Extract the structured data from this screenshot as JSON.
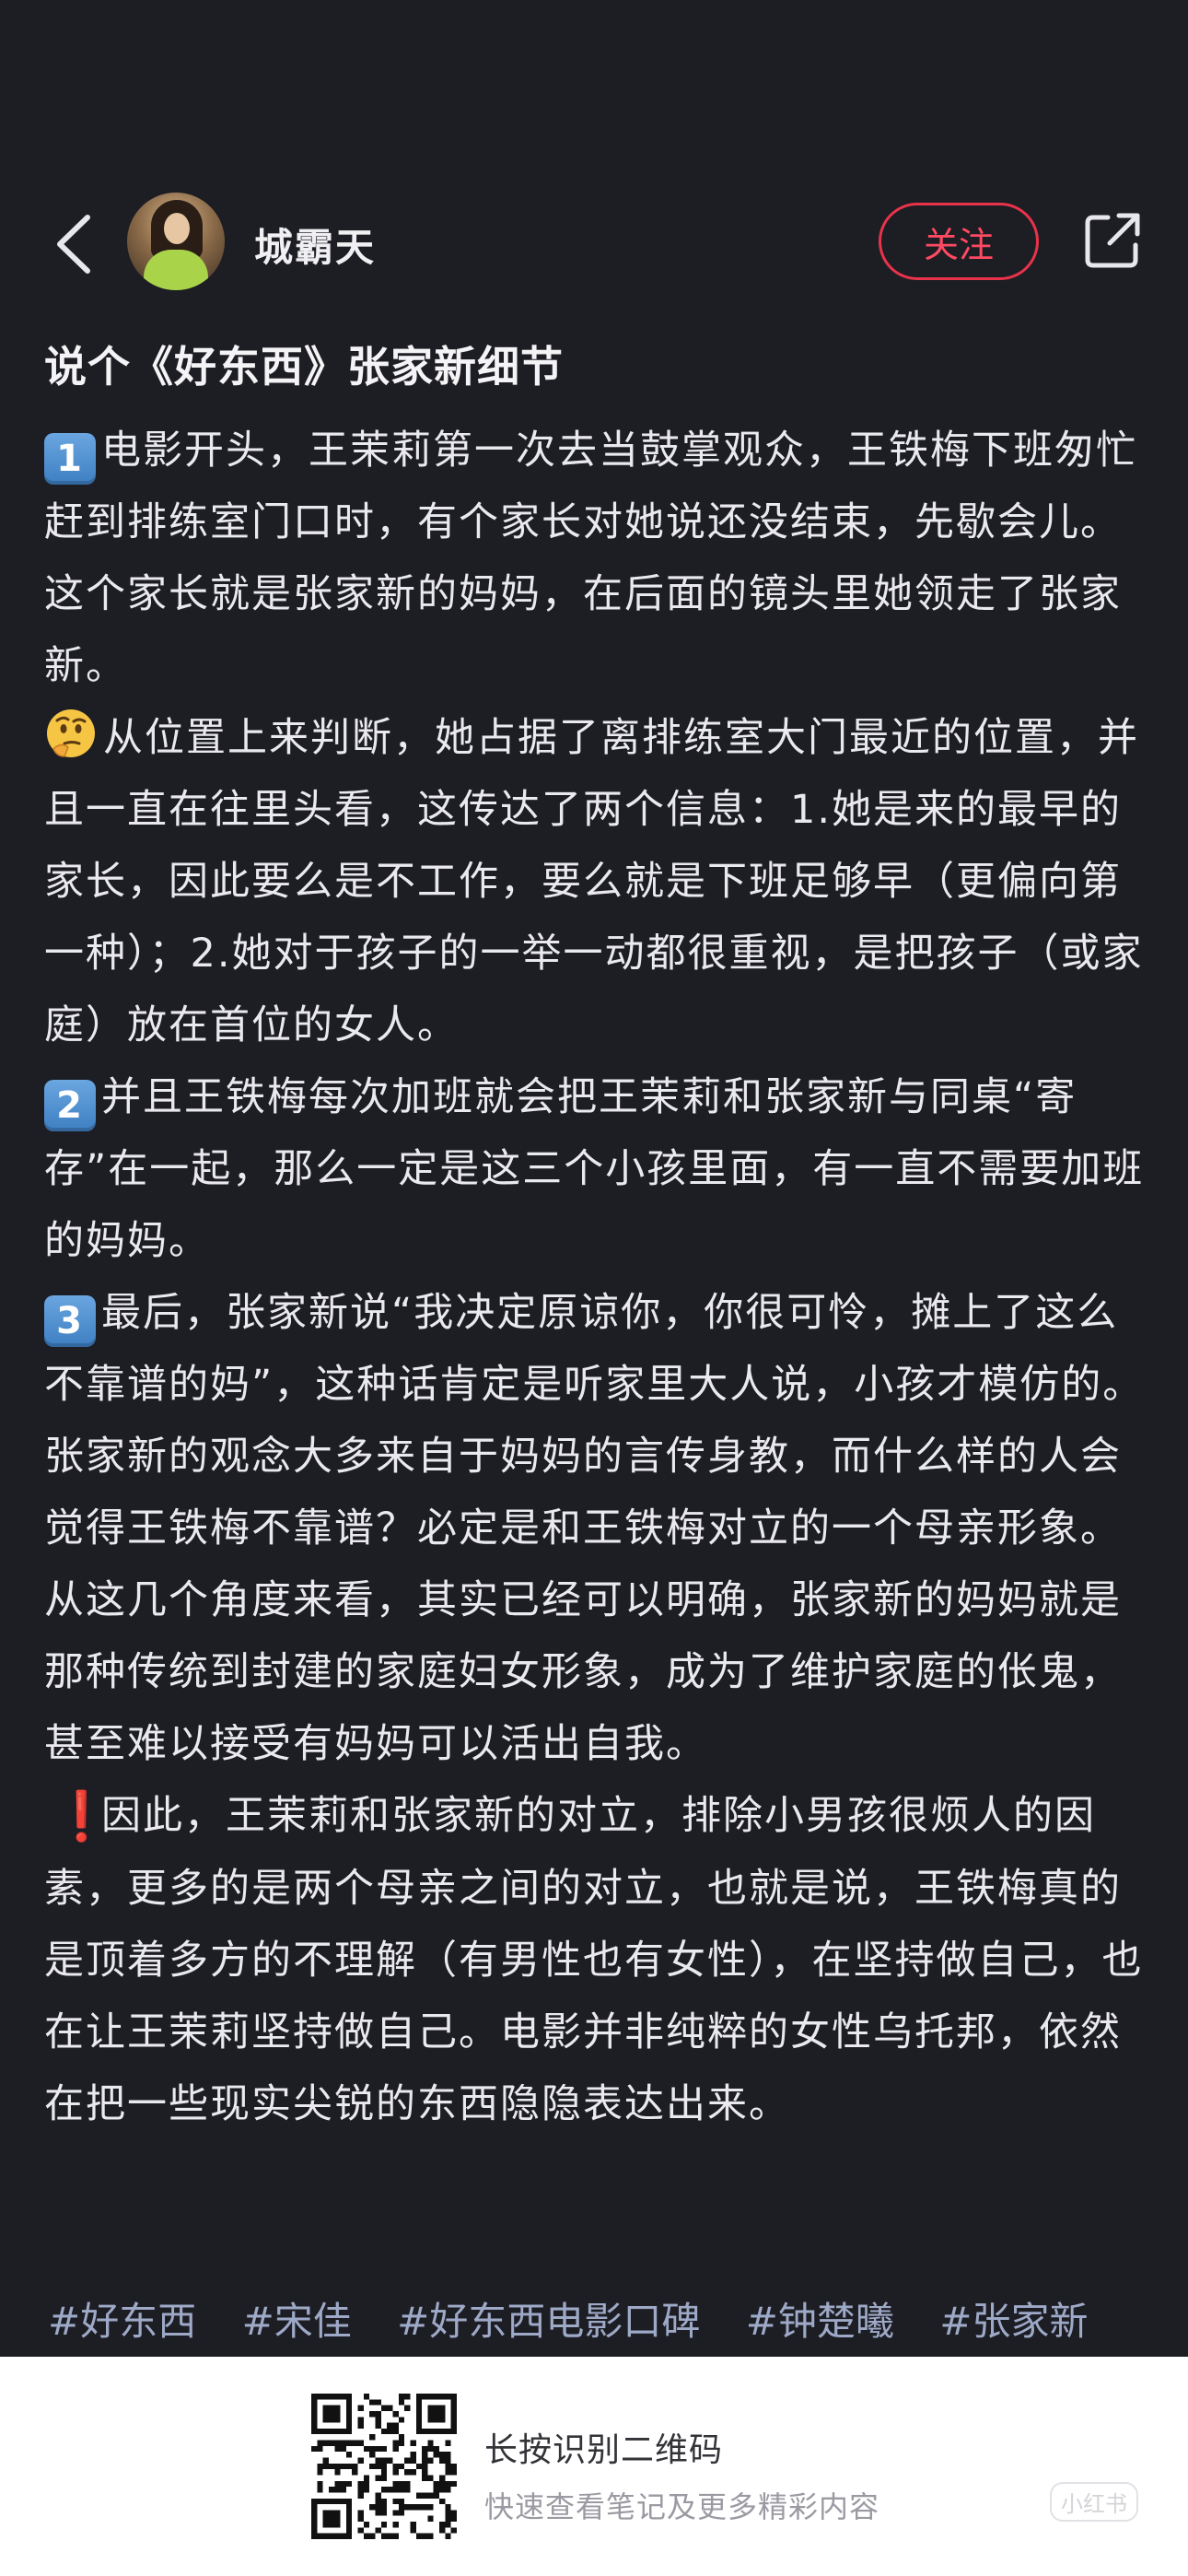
{
  "header": {
    "username": "城霸天",
    "follow_label": "关注"
  },
  "note": {
    "title": "说个《好东西》张家新细节",
    "paragraphs": [
      {
        "icon": "keycap-1",
        "icon_text": "1",
        "text": "电影开头，王茉莉第一次去当鼓掌观众，王铁梅下班匆忙赶到排练室门口时，有个家长对她说还没结束，先歇会儿。这个家长就是张家新的妈妈，在后面的镜头里她领走了张家新。"
      },
      {
        "icon": "thinking-face",
        "icon_text": "",
        "text": "从位置上来判断，她占据了离排练室大门最近的位置，并且一直在往里头看，这传达了两个信息：1.她是来的最早的家长，因此要么是不工作，要么就是下班足够早（更偏向第一种）；2.她对于孩子的一举一动都很重视，是把孩子（或家庭）放在首位的女人。"
      },
      {
        "icon": "keycap-2",
        "icon_text": "2",
        "text": "并且王铁梅每次加班就会把王茉莉和张家新与同桌“寄存”在一起，那么一定是这三个小孩里面，有一直不需要加班的妈妈。"
      },
      {
        "icon": "keycap-3",
        "icon_text": "3",
        "text": "最后，张家新说“我决定原谅你，你很可怜，摊上了这么不靠谱的妈”，这种话肯定是听家里大人说，小孩才模仿的。张家新的观念大多来自于妈妈的言传身教，而什么样的人会觉得王铁梅不靠谱？必定是和王铁梅对立的一个母亲形象。从这几个角度来看，其实已经可以明确，张家新的妈妈就是那种传统到封建的家庭妇女形象，成为了维护家庭的伥鬼，甚至难以接受有妈妈可以活出自我。"
      },
      {
        "icon": "exclamation",
        "icon_text": "❗",
        "text": "因此，王茉莉和张家新的对立，排除小男孩很烦人的因素，更多的是两个母亲之间的对立，也就是说，王铁梅真的是顶着多方的不理解（有男性也有女性），在坚持做自己，也在让王茉莉坚持做自己。电影并非纯粹的女性乌托邦，依然在把一些现实尖锐的东西隐隐表达出来。"
      }
    ],
    "tags": [
      "#好东西",
      "#宋佳",
      "#好东西电影口碑",
      "#钟楚曦",
      "#张家新"
    ]
  },
  "footer": {
    "qr_title": "长按识别二维码",
    "qr_subtitle": "快速查看笔记及更多精彩内容",
    "watermark": "小红书"
  },
  "colors": {
    "background": "#1d1d24",
    "follow_accent": "#e8334a",
    "tag_color": "#9da9c6"
  }
}
